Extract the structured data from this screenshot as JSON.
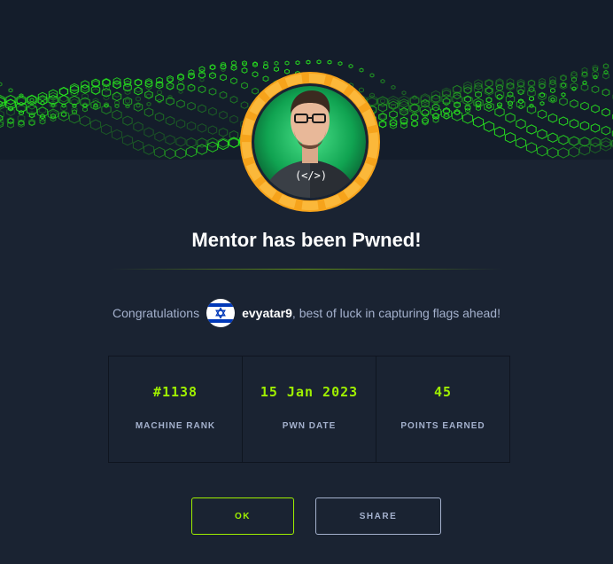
{
  "colors": {
    "background": "#1a2332",
    "accent": "#9fef00",
    "avatar_ring": "#f6a31b",
    "text_muted": "#a4b1cd"
  },
  "banner": {
    "icon": "green-hexagon-grid-wave"
  },
  "avatar": {
    "icon": "machine-avatar-icon",
    "badge_text": "(</>)"
  },
  "title": "Mentor has been Pwned!",
  "congrats": {
    "prefix": "Congratulations",
    "flag": "israel-flag-icon",
    "username": "evyatar9",
    "suffix": ", best of luck in capturing flags ahead!"
  },
  "stats": [
    {
      "value": "#1138",
      "label": "MACHINE RANK"
    },
    {
      "value": "15 Jan 2023",
      "label": "PWN DATE"
    },
    {
      "value": "45",
      "label": "POINTS EARNED"
    }
  ],
  "buttons": {
    "ok": "OK",
    "share": "SHARE"
  }
}
